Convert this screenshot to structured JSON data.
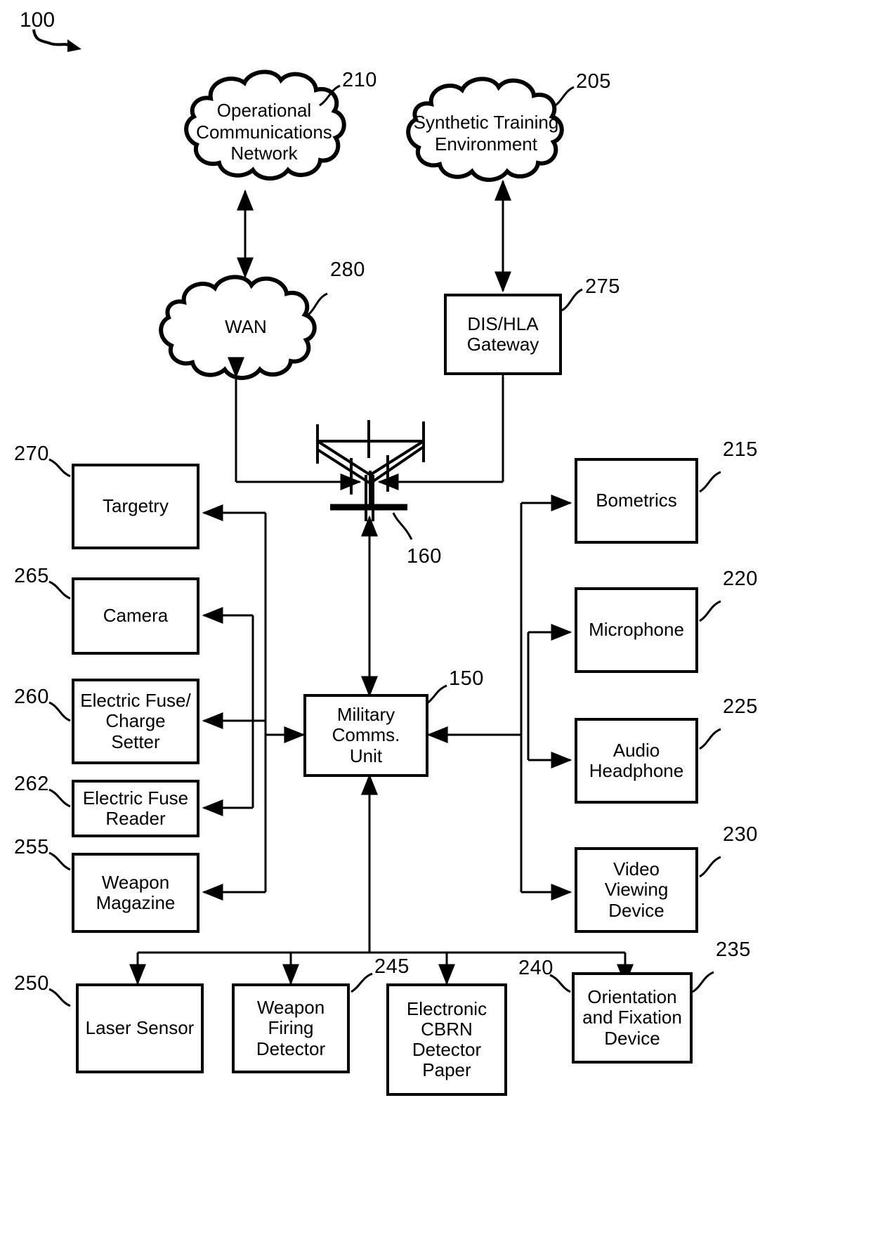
{
  "figure": {
    "label": "100",
    "title": "Military communications system block diagram"
  },
  "clouds": [
    {
      "id": "210",
      "label": "Operational\nCommunications\nNetwork",
      "name": "operational-communications-network"
    },
    {
      "id": "205",
      "label": "Synthetic Training\nEnvironment",
      "name": "synthetic-training-environment"
    },
    {
      "id": "280",
      "label": "WAN",
      "name": "wan"
    }
  ],
  "cloud_texts": {
    "c210_l1": "Operational",
    "c210_l2": "Communications",
    "c210_l3": "Network",
    "c205_l1": "Synthetic Training",
    "c205_l2": "Environment",
    "c280_l1": "WAN"
  },
  "nodes": {
    "gateway": {
      "ref": "275",
      "lines": [
        "DIS/HLA",
        "Gateway"
      ]
    },
    "antenna": {
      "ref": "160",
      "lines": []
    },
    "comms_unit": {
      "ref": "150",
      "lines": [
        "Military",
        "Comms.",
        "Unit"
      ]
    },
    "targetry": {
      "ref": "270",
      "lines": [
        "Targetry"
      ]
    },
    "camera": {
      "ref": "265",
      "lines": [
        "Camera"
      ]
    },
    "fuse_setter": {
      "ref": "260",
      "lines": [
        "Electric Fuse/",
        "Charge",
        "Setter"
      ]
    },
    "fuse_reader": {
      "ref": "262",
      "lines": [
        "Electric Fuse",
        "Reader"
      ]
    },
    "magazine": {
      "ref": "255",
      "lines": [
        "Weapon",
        "Magazine"
      ]
    },
    "biometrics": {
      "ref": "215",
      "lines": [
        "Bometrics"
      ]
    },
    "microphone": {
      "ref": "220",
      "lines": [
        "Microphone"
      ]
    },
    "headphone": {
      "ref": "225",
      "lines": [
        "Audio",
        "Headphone"
      ]
    },
    "video_device": {
      "ref": "230",
      "lines": [
        "Video",
        "Viewing",
        "Device"
      ]
    },
    "laser_sensor": {
      "ref": "250",
      "lines": [
        "Laser Sensor"
      ]
    },
    "firing_det": {
      "ref": "245",
      "lines": [
        "Weapon",
        "Firing",
        "Detector"
      ]
    },
    "cbrn": {
      "ref": "240",
      "lines": [
        "Electronic",
        "CBRN",
        "Detector",
        "Paper"
      ]
    },
    "orientation": {
      "ref": "235",
      "lines": [
        "Orientation",
        "and Fixation",
        "Device"
      ]
    }
  },
  "node_text": {
    "gateway_1": "DIS/HLA",
    "gateway_2": "Gateway",
    "comms_1": "Military",
    "comms_2": "Comms.",
    "comms_3": "Unit",
    "targetry_1": "Targetry",
    "camera_1": "Camera",
    "fuse_setter_1": "Electric Fuse/",
    "fuse_setter_2": "Charge",
    "fuse_setter_3": "Setter",
    "fuse_reader_1": "Electric Fuse",
    "fuse_reader_2": "Reader",
    "magazine_1": "Weapon",
    "magazine_2": "Magazine",
    "biometrics_1": "Bometrics",
    "microphone_1": "Microphone",
    "headphone_1": "Audio",
    "headphone_2": "Headphone",
    "video_1": "Video",
    "video_2": "Viewing",
    "video_3": "Device",
    "laser_1": "Laser Sensor",
    "firing_1": "Weapon",
    "firing_2": "Firing",
    "firing_3": "Detector",
    "cbrn_1": "Electronic",
    "cbrn_2": "CBRN",
    "cbrn_3": "Detector",
    "cbrn_4": "Paper",
    "orientation_1": "Orientation",
    "orientation_2": "and Fixation",
    "orientation_3": "Device"
  },
  "reference_numerals": {
    "fig": "100",
    "n205": "205",
    "n210": "210",
    "n215": "215",
    "n220": "220",
    "n225": "225",
    "n230": "230",
    "n235": "235",
    "n240": "240",
    "n245": "245",
    "n250": "250",
    "n255": "255",
    "n260": "260",
    "n262": "262",
    "n265": "265",
    "n270": "270",
    "n275": "275",
    "n280": "280",
    "n150": "150",
    "n160": "160"
  },
  "colors": {
    "stroke": "#000000",
    "background": "#ffffff"
  }
}
